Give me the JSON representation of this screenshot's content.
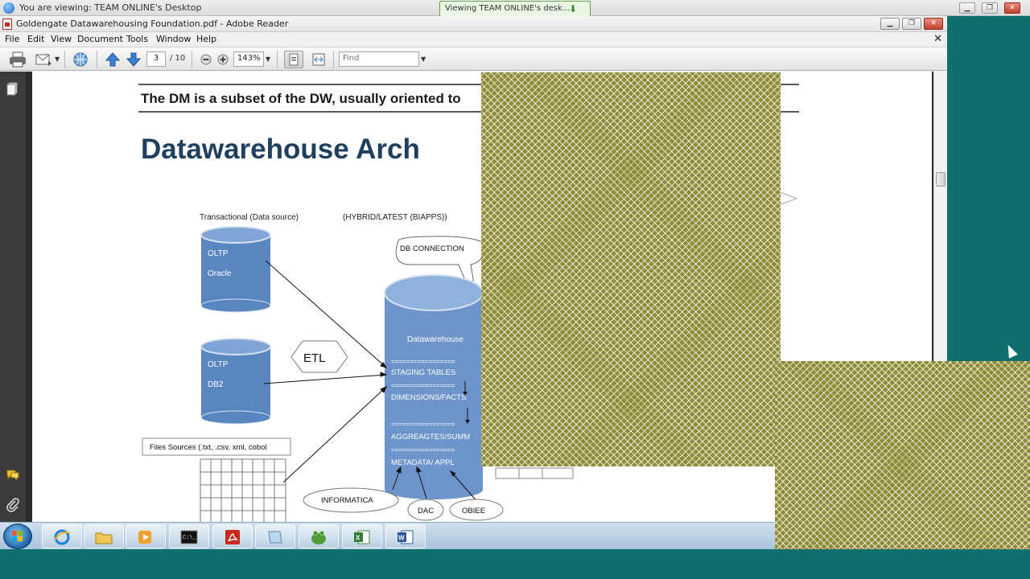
{
  "teamviewer": {
    "title": "You are viewing: TEAM ONLINE's Desktop",
    "notification": "Viewing TEAM ONLINE's desk...",
    "controls": {
      "minimize": "▁",
      "restore": "❐",
      "close": "✕"
    }
  },
  "reader": {
    "title": "Goldengate Datawarehousing Foundation.pdf - Adobe Reader",
    "menu": [
      "File",
      "Edit",
      "View",
      "Document",
      "Tools",
      "Window",
      "Help"
    ],
    "doc_close": "✕",
    "toolbar": {
      "page_current": "3",
      "page_total": "/ 10",
      "zoom": "143%",
      "find_placeholder": "Find"
    }
  },
  "document": {
    "subtitle": "The DM is a subset of the DW, usually oriented to",
    "title": "Datawarehouse Arch",
    "labels": {
      "transactional": "Transactional (Data source)",
      "hybrid": "(HYBRID/LATEST (BIAPPS))",
      "db_connection": "DB CONNECTION",
      "oltp1_a": "OLTP",
      "oltp1_b": "Oracle",
      "oltp2_a": "OLTP",
      "oltp2_b": "DB2",
      "etl": "ETL",
      "files": "Files Sources (.txt, .csv, xml, cobol",
      "dw": "Datawarehouse",
      "sep": "=================",
      "staging": "STAGING TABLES",
      "dims": "DIMENSIONS/FACTS",
      "aggr": "AGGREAGTES/SUMM",
      "meta": "METADATA/  APPL",
      "informatica": "INFORMATICA",
      "dac": "DAC",
      "obiee": "OBIEE"
    }
  },
  "colors": {
    "desktop": "#0f6e6e",
    "cylinder": "#5a86c0",
    "title_text": "#1f3f5f",
    "pattern": "#8f8c38"
  },
  "taskbar": {
    "items": [
      "internet-explorer-icon",
      "explorer-folder-icon",
      "media-player-icon",
      "command-prompt-icon",
      "adobe-reader-icon",
      "notes-icon",
      "teamviewer-frog-icon",
      "excel-icon",
      "word-icon"
    ]
  }
}
